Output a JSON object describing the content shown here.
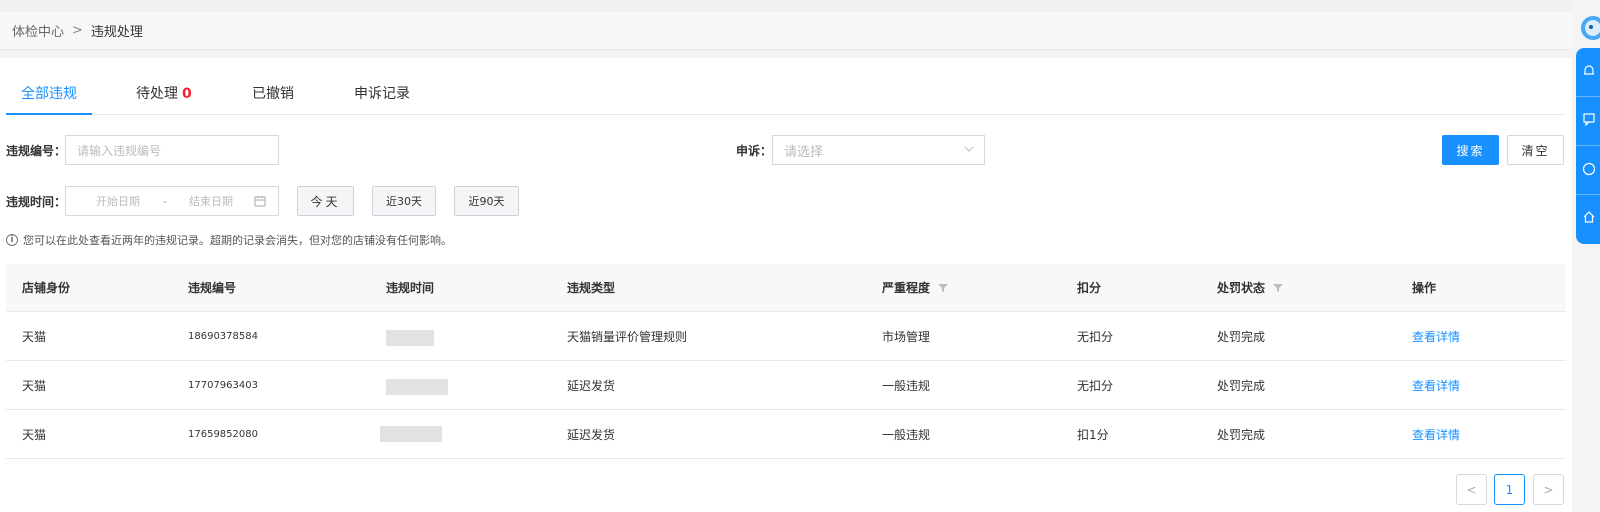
{
  "breadcrumb": {
    "root": "体检中心",
    "separator": ">",
    "current": "违规处理"
  },
  "tabs": [
    {
      "label": "全部违规",
      "active": true,
      "badge": ""
    },
    {
      "label": "待处理",
      "active": false,
      "badge": "0"
    },
    {
      "label": "已撤销",
      "active": false,
      "badge": ""
    },
    {
      "label": "申诉记录",
      "active": false,
      "badge": ""
    }
  ],
  "filters": {
    "violation_no_label": "违规编号：",
    "violation_no_placeholder": "请输入违规编号",
    "appeal_label": "申诉：",
    "appeal_placeholder": "请选择",
    "time_label": "违规时间：",
    "start_placeholder": "开始日期",
    "range_sep": "-",
    "end_placeholder": "结束日期",
    "quick_today": "今天",
    "quick_30": "近30天",
    "quick_90": "近90天",
    "search_label": "搜索",
    "clear_label": "清空"
  },
  "notice": "您可以在此处查看近两年的违规记录。超期的记录会消失，但对您的店铺没有任何影响。",
  "table": {
    "headers": {
      "shop": "店铺身份",
      "no": "违规编号",
      "time": "违规时间",
      "type": "违规类型",
      "severity": "严重程度",
      "points": "扣分",
      "status": "处罚状态",
      "action": "操作"
    },
    "rows": [
      {
        "shop": "天猫",
        "no": "18690378584",
        "type": "天猫销量评价管理规则",
        "severity": "市场管理",
        "points": "无扣分",
        "status": "处罚完成",
        "action": "查看详情"
      },
      {
        "shop": "天猫",
        "no": "17707963403",
        "type": "延迟发货",
        "severity": "一般违规",
        "points": "无扣分",
        "status": "处罚完成",
        "action": "查看详情"
      },
      {
        "shop": "天猫",
        "no": "17659852080",
        "type": "延迟发货",
        "severity": "一般违规",
        "points": "扣1分",
        "status": "处罚完成",
        "action": "查看详情"
      }
    ]
  },
  "pagination": {
    "prev": "<",
    "current": "1",
    "next": ">"
  },
  "colors": {
    "accent": "#1890ff",
    "badge": "#f5222d"
  },
  "sidebar_icons": [
    "bell-icon",
    "message-icon",
    "help-icon",
    "home-icon"
  ]
}
